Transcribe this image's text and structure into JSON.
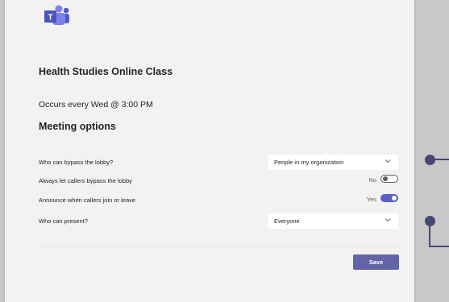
{
  "meeting": {
    "title": "Health Studies Online Class",
    "occurs": "Occurs every Wed @ 3:00 PM"
  },
  "options": {
    "heading": "Meeting options",
    "bypass_lobby": {
      "label": "Who can bypass the lobby?",
      "value": "People in my organization"
    },
    "callers_bypass": {
      "label": "Always let callers bypass the lobby",
      "state_text": "No",
      "on": false
    },
    "announce": {
      "label": "Announce when callers join or leave",
      "state_text": "Yes",
      "on": true
    },
    "presenters": {
      "label": "Who can present?",
      "value": "Everyone"
    }
  },
  "actions": {
    "save_label": "Save"
  },
  "colors": {
    "accent": "#6264a7",
    "toggle_on": "#5b5fc7",
    "callout": "#464775",
    "panel": "#f3f2f1"
  },
  "icons": {
    "logo": "teams-logo-icon",
    "dropdown": "chevron-down-icon"
  }
}
